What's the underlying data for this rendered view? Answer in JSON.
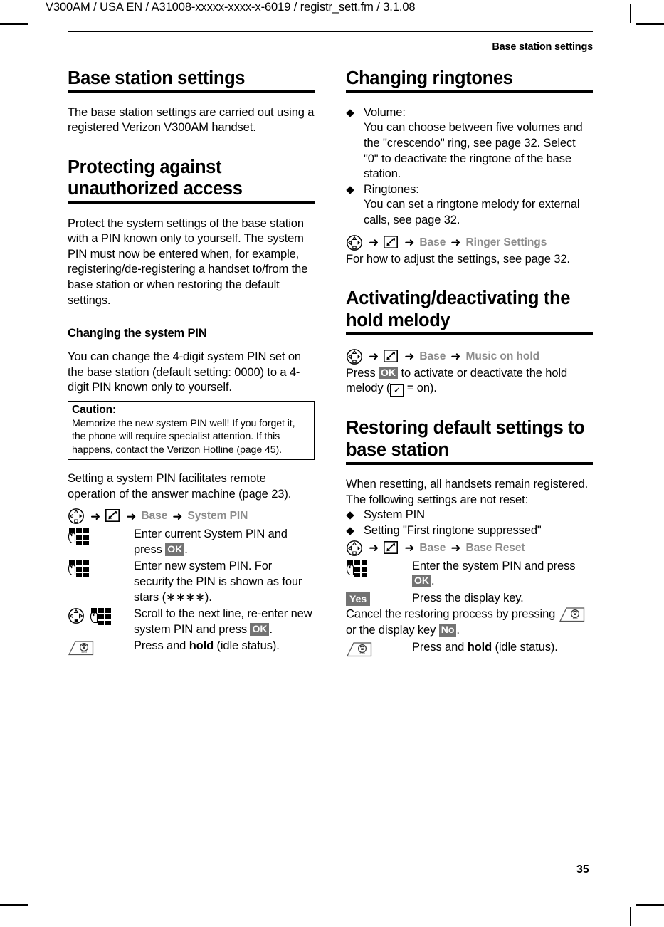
{
  "page": {
    "header_line": "V300AM / USA EN / A31008-xxxxx-xxxx-x-6019 / registr_sett.fm / 3.1.08",
    "running_head": "Base station settings",
    "page_number": "35"
  },
  "icons": {
    "control_key": "control-key-icon",
    "settings_key": "settings-display-key-icon",
    "keypad": "keypad-digit-keys-icon",
    "end_call_key": "end-call-key-icon",
    "arrow": "➜",
    "diamond": "◆",
    "check": "✓"
  },
  "left_column": {
    "title": "Base station settings",
    "intro": "The base station settings are carried out using a registered Verizon V300AM handset.",
    "section_protect": {
      "heading": "Protecting against unauthorized access",
      "body": "Protect the system settings of the base station with a PIN known only to yourself. The system PIN must now be entered when, for example, registering/de-registering a handset to/from the base station or when restoring the default settings."
    },
    "section_pin": {
      "heading": "Changing the system PIN",
      "body": "You can change the 4-digit system PIN set on the base station (default setting: 0000) to a 4-digit PIN known only to yourself.",
      "caution": {
        "title": "Caution:",
        "text": "Memorize the new system PIN well! If you forget it, the phone will require specialist attention. If this happens, contact the Verizon Hotline (page 45)."
      },
      "after_caution": "Setting a system PIN facilitates remote operation of the answer machine (page 23).",
      "menu_path": {
        "item1": "Base",
        "item2": "System PIN"
      },
      "steps": [
        {
          "icon": "keypad",
          "text_before": "Enter current System PIN and press ",
          "badge": "OK",
          "text_after": "."
        },
        {
          "icon": "keypad",
          "text_before": "Enter new system PIN. For security the PIN is shown as four stars (∗∗∗∗).",
          "badge": "",
          "text_after": ""
        },
        {
          "icon": "control-keypad",
          "text_before": "Scroll to the next line, re-enter new system PIN and press ",
          "badge": "OK",
          "text_after": "."
        },
        {
          "icon": "endkey",
          "text_before": "Press and ",
          "bold": "hold",
          "text_after": " (idle status)."
        }
      ]
    }
  },
  "right_column": {
    "section_ringtones": {
      "heading": "Changing ringtones",
      "bullets": [
        {
          "label": "Volume:",
          "body": "You can choose between five volumes and the \"crescendo\" ring, see page 32. Select \"0\" to deactivate the ringtone of the base station."
        },
        {
          "label": "Ringtones:",
          "body": "You can set a ringtone melody for external calls, see page 32."
        }
      ],
      "menu_path": {
        "item1": "Base",
        "item2": "Ringer Settings"
      },
      "after_path": "For how to adjust the settings, see page 32."
    },
    "section_hold": {
      "heading": "Activating/deactivating the hold melody",
      "menu_path": {
        "item1": "Base",
        "item2": "Music on hold"
      },
      "body_before": "Press ",
      "badge": "OK",
      "body_middle": " to activate or deactivate the hold melody (",
      "body_after": " = on)."
    },
    "section_reset": {
      "heading": "Restoring default settings to base station",
      "body": "When resetting, all handsets remain registered. The following settings are not reset:",
      "bullets": [
        "System PIN",
        "Setting \"First ringtone suppressed\""
      ],
      "menu_path": {
        "item1": "Base",
        "item2": "Base Reset"
      },
      "steps": [
        {
          "icon": "keypad",
          "text_before": "Enter the system PIN and press ",
          "badge": "OK",
          "text_after": "."
        },
        {
          "icon": "badge-yes",
          "badge_label": "Yes",
          "text_before": "Press the display key.",
          "text_after": ""
        }
      ],
      "cancel_before": "Cancel the restoring process by pressing ",
      "cancel_middle": " or the display key ",
      "cancel_badge": "No",
      "cancel_after": ".",
      "final_step": {
        "icon": "endkey",
        "text_before": "Press and ",
        "bold": "hold",
        "text_after": " (idle status)."
      }
    }
  }
}
